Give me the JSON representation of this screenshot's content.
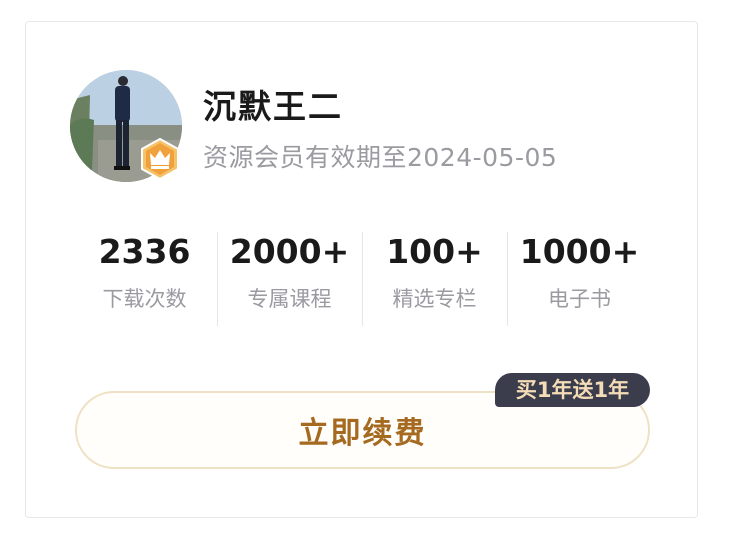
{
  "profile": {
    "username": "沉默王二",
    "member_expiry": "资源会员有效期至2024-05-05",
    "badge_icon": "crown-icon"
  },
  "stats": [
    {
      "value": "2336",
      "label": "下载次数"
    },
    {
      "value": "2000+",
      "label": "专属课程"
    },
    {
      "value": "100+",
      "label": "精选专栏"
    },
    {
      "value": "1000+",
      "label": "电子书"
    }
  ],
  "renew": {
    "label": "立即续费",
    "promo": "买1年送1年"
  },
  "colors": {
    "accent_gold": "#a56a1f",
    "badge_orange": "#f0a13c",
    "promo_bg": "#3b3d4d",
    "promo_text": "#f3dcb6"
  }
}
